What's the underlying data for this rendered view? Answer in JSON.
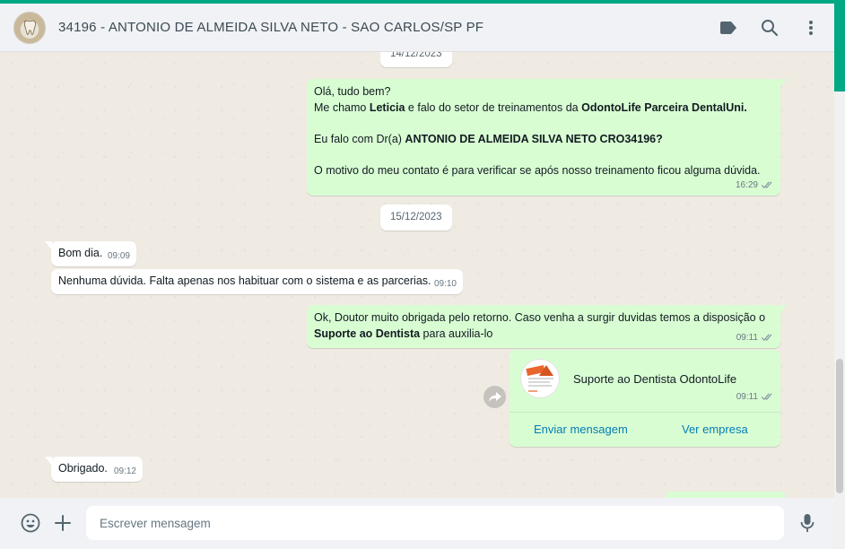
{
  "header": {
    "contact_name": "34196 - ANTONIO DE ALMEIDA SILVA NETO - SAO CARLOS/SP PF",
    "icons": [
      "label-icon",
      "search-icon",
      "menu-icon"
    ]
  },
  "chat": {
    "date_chip_1": "14/12/2023",
    "date_chip_2": "15/12/2023",
    "msg1": {
      "line1": "Olá, tudo bem?",
      "line2_a": "Me chamo ",
      "line2_name": "Leticia",
      "line2_b": " e falo do setor de treinamentos  da ",
      "line2_company": "OdontoLife Parceira DentalUni.",
      "line3_a": " Eu falo com Dr(a) ",
      "line3_name": "ANTONIO DE ALMEIDA SILVA NETO CRO34196?",
      "line4": "O motivo do meu contato é para verificar se após nosso treinamento ficou alguma dúvida.",
      "time": "16:29"
    },
    "msg2": {
      "text": "Bom dia.",
      "time": "09:09"
    },
    "msg3": {
      "text": "Nenhuma dúvida. Falta apenas nos habituar com o sistema e as parcerias.",
      "time": "09:10"
    },
    "msg4": {
      "text_a": "Ok, Doutor muito obrigada pelo retorno. Caso venha a surgir duvidas temos a disposição o",
      "text_bold": "Suporte ao Dentista",
      "text_b": " para auxilia-lo",
      "time": "09:11"
    },
    "card": {
      "name": "Suporte ao Dentista OdontoLife",
      "time": "09:11",
      "send_label": "Enviar mensagem",
      "view_label": "Ver empresa"
    },
    "msg5": {
      "text": "Obrigado.",
      "time": "09:12"
    }
  },
  "footer": {
    "placeholder": "Escrever mensagem",
    "icons": [
      "emoji-icon",
      "attach-icon",
      "microphone-icon"
    ]
  },
  "colors": {
    "outgoing_bubble": "#d9fdd3",
    "incoming_bubble": "#ffffff",
    "accent": "#00a884",
    "link": "#027eb5"
  }
}
